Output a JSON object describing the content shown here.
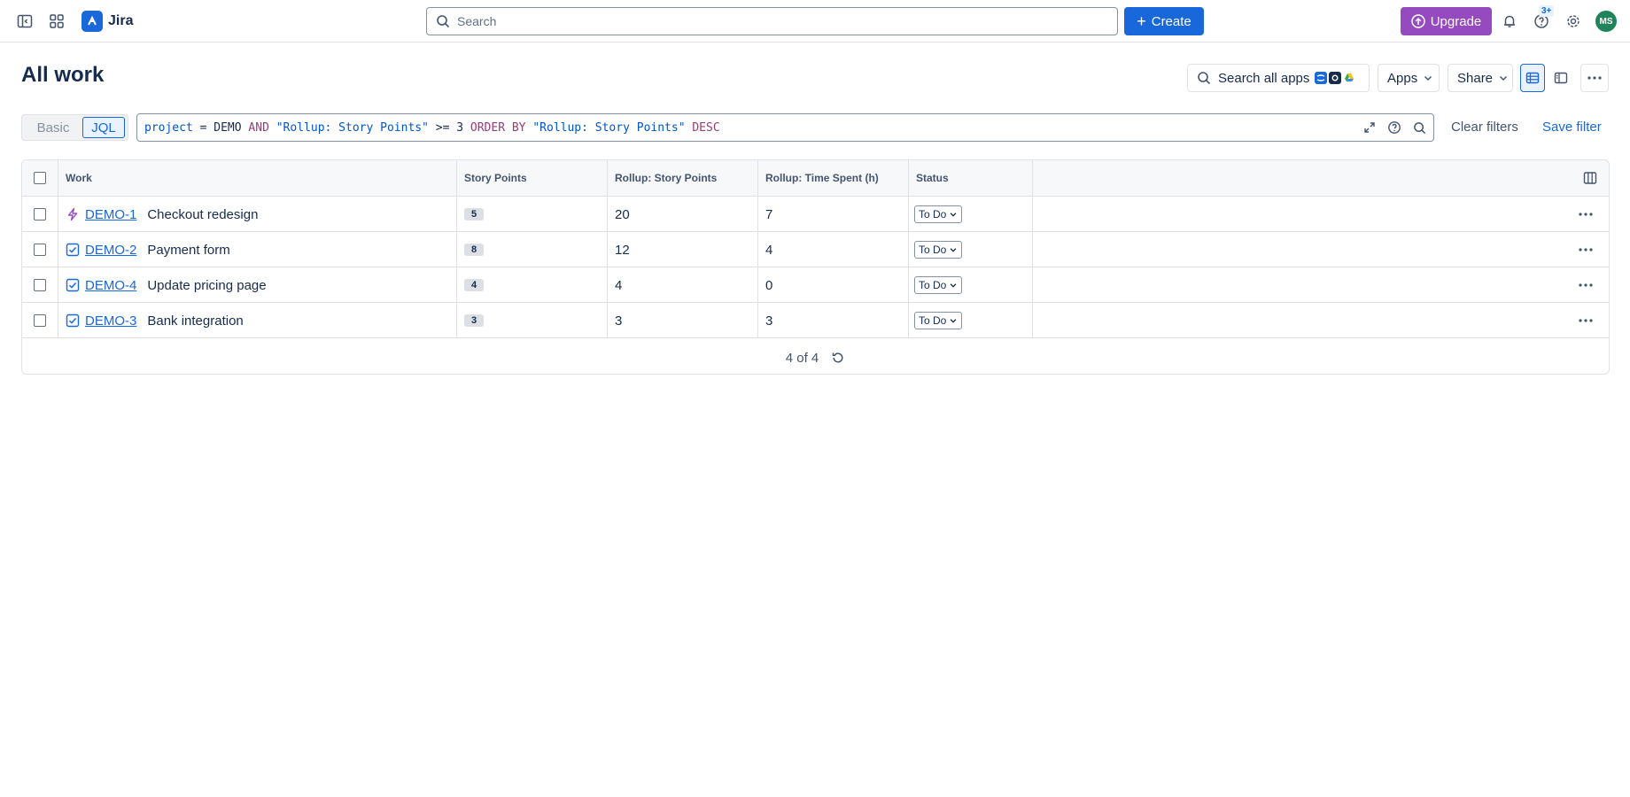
{
  "topbar": {
    "brand": "Jira",
    "search_placeholder": "Search",
    "create_label": "Create",
    "upgrade_label": "Upgrade",
    "help_badge": "3+",
    "avatar_initials": "MS"
  },
  "header": {
    "title": "All work",
    "search_apps_label": "Search all apps",
    "apps_label": "Apps",
    "share_label": "Share"
  },
  "filter": {
    "basic_label": "Basic",
    "jql_label": "JQL",
    "jql_parts": {
      "p1": "project",
      "p2": " = ",
      "p3": "DEMO",
      "p4": " AND ",
      "p5": "\"Rollup: Story Points\"",
      "p6": " >= ",
      "p7": "3",
      "p8": " ORDER BY ",
      "p9": "\"Rollup: Story Points\"",
      "p10": " DESC"
    },
    "clear_label": "Clear filters",
    "save_label": "Save filter"
  },
  "table": {
    "columns": [
      "Work",
      "Story Points",
      "Rollup: Story Points",
      "Rollup: Time Spent (h)",
      "Status"
    ],
    "rows": [
      {
        "type": "epic",
        "key": "DEMO-1",
        "summary": "Checkout redesign",
        "story_points": "5",
        "rollup_points": "20",
        "rollup_time": "7",
        "status": "To Do"
      },
      {
        "type": "task",
        "key": "DEMO-2",
        "summary": "Payment form",
        "story_points": "8",
        "rollup_points": "12",
        "rollup_time": "4",
        "status": "To Do"
      },
      {
        "type": "task",
        "key": "DEMO-4",
        "summary": "Update pricing page",
        "story_points": "4",
        "rollup_points": "4",
        "rollup_time": "0",
        "status": "To Do"
      },
      {
        "type": "task",
        "key": "DEMO-3",
        "summary": "Bank integration",
        "story_points": "3",
        "rollup_points": "3",
        "rollup_time": "3",
        "status": "To Do"
      }
    ],
    "footer_count": "4 of 4"
  },
  "colors": {
    "primary": "#1868db",
    "upgrade": "#964ac0",
    "avatar": "#1f845a",
    "epic_icon": "#964ac0",
    "task_icon": "#1868db"
  }
}
